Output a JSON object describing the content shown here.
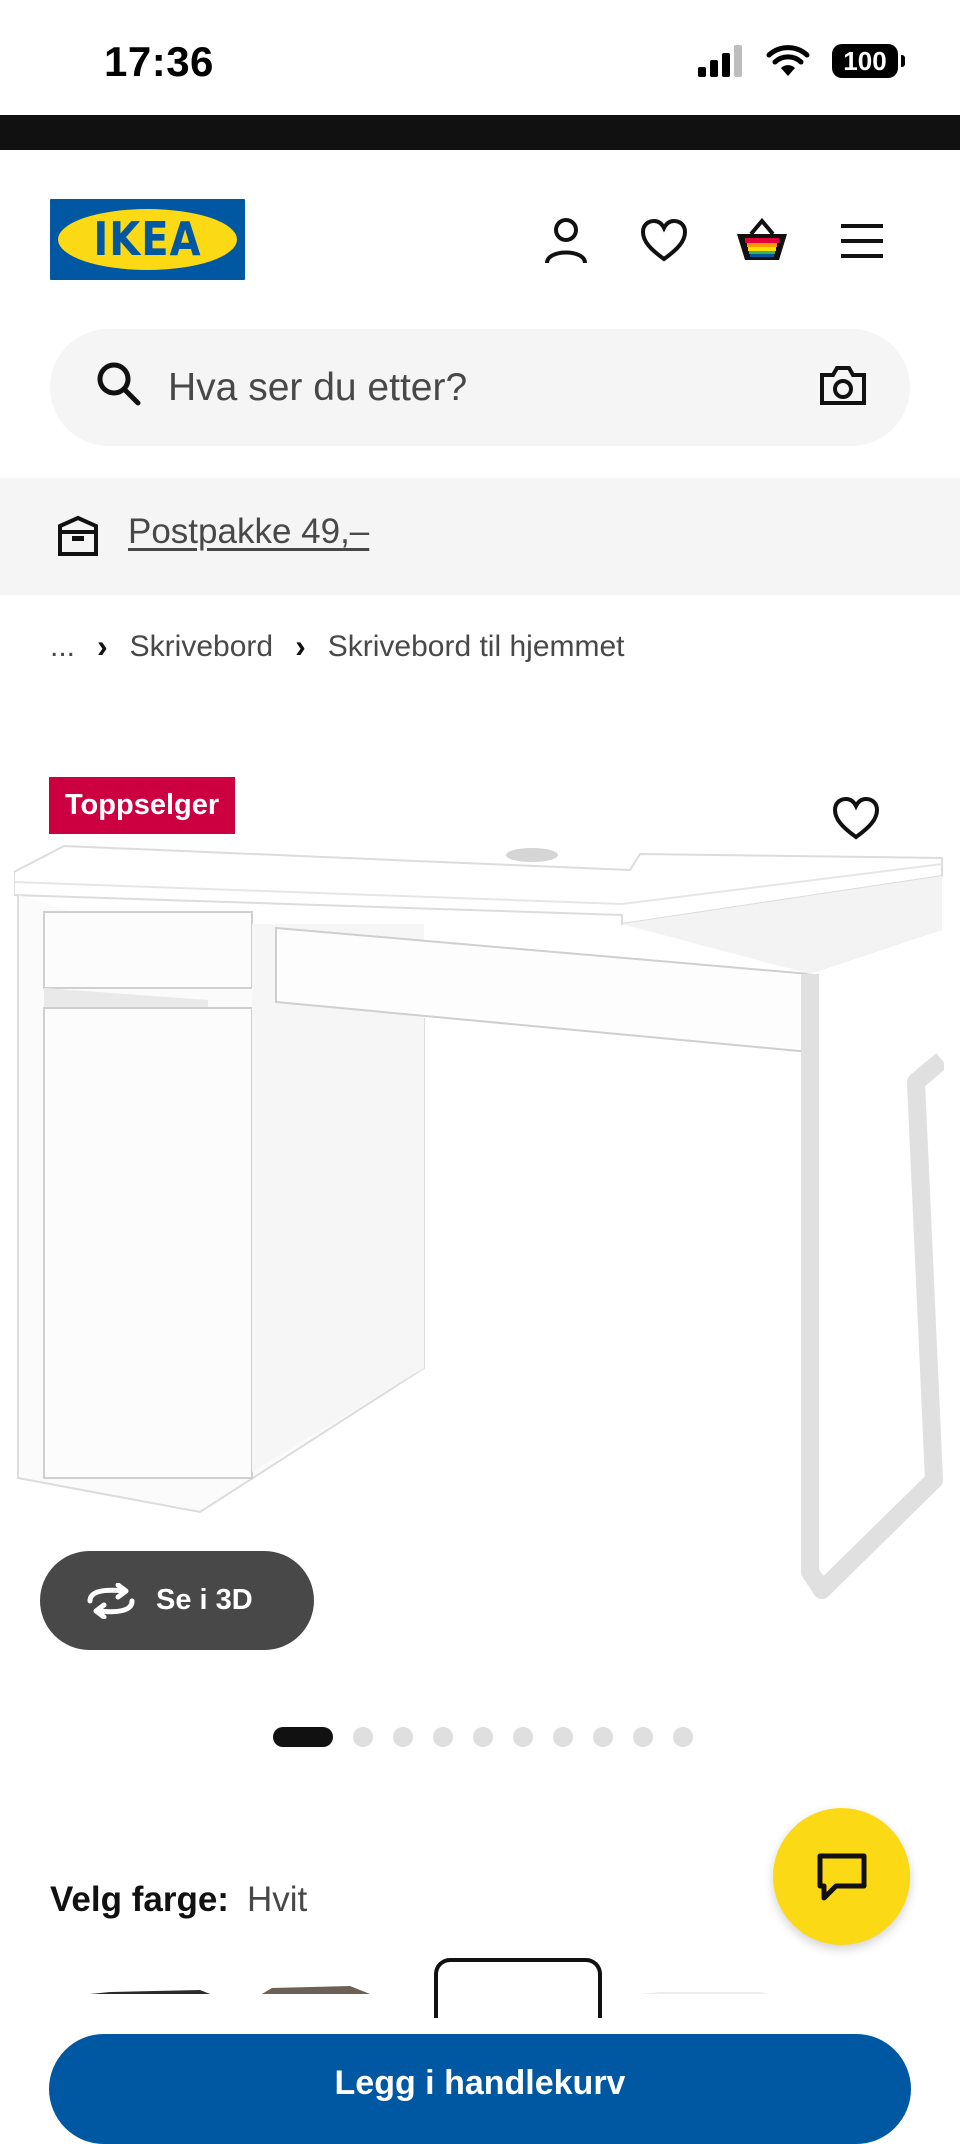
{
  "status_bar": {
    "time": "17:36",
    "battery": "100"
  },
  "header": {
    "logo_text": "IKEA",
    "icons": [
      "user-icon",
      "heart-icon",
      "basket-icon",
      "menu-icon"
    ]
  },
  "search": {
    "placeholder": "Hva ser du etter?"
  },
  "banner": {
    "text": "Postpakke 49,–"
  },
  "breadcrumb": {
    "ellipsis": "...",
    "items": [
      "Skrivebord",
      "Skrivebord til hjemmet"
    ]
  },
  "product": {
    "badge": "Toppselger",
    "view_3d_label": "Se i 3D",
    "carousel": {
      "total": 10,
      "active_index": 0
    }
  },
  "color": {
    "label": "Velg farge:",
    "value": "Hvit"
  },
  "cta": {
    "add_label": "Legg i handlekurv"
  },
  "colors": {
    "ikea_blue": "#0058a3",
    "ikea_yellow": "#fbd914",
    "badge_red": "#cc0040"
  }
}
